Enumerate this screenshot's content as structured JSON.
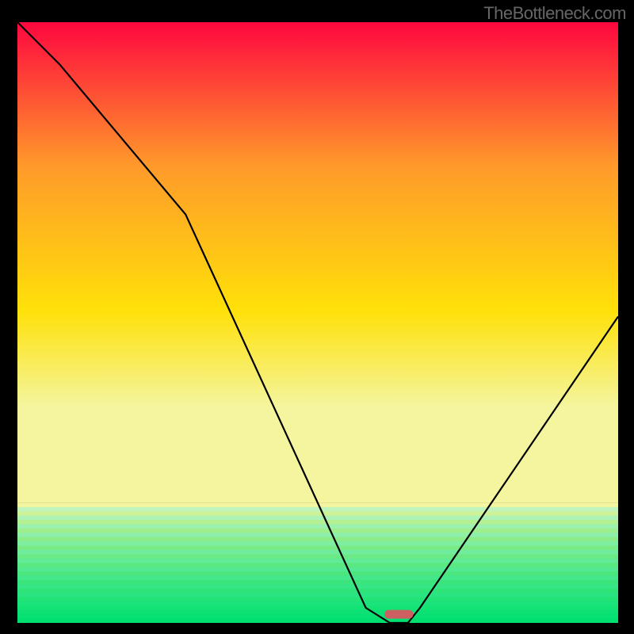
{
  "attribution": "TheBottleneck.com",
  "chart_data": {
    "type": "line",
    "title": "",
    "xlabel": "",
    "ylabel": "",
    "xlim": [
      0,
      100
    ],
    "ylim": [
      0,
      100
    ],
    "series": [
      {
        "name": "bottleneck-curve",
        "x": [
          0,
          7,
          28,
          58,
          62,
          65,
          67,
          100
        ],
        "values": [
          100,
          93,
          68,
          2.5,
          0,
          0,
          2.5,
          51
        ]
      }
    ],
    "marker": {
      "x": 63.5,
      "y": 1.5
    },
    "gradient_bands": [
      {
        "from": 0,
        "to": 80,
        "type": "smooth_red_to_yellow_green"
      },
      {
        "from": 80,
        "to": 100,
        "type": "striped_green"
      }
    ]
  },
  "colors": {
    "frame": "#000000",
    "attribution": "#666666",
    "curve": "#000000",
    "marker": "#cc6060",
    "gradient_top": "#fe073f",
    "gradient_mid1": "#ff9a2a",
    "gradient_mid2": "#ffe109",
    "gradient_low": "#f4f59e",
    "green_light": "#c9f6c1",
    "green_deep": "#00e070"
  }
}
